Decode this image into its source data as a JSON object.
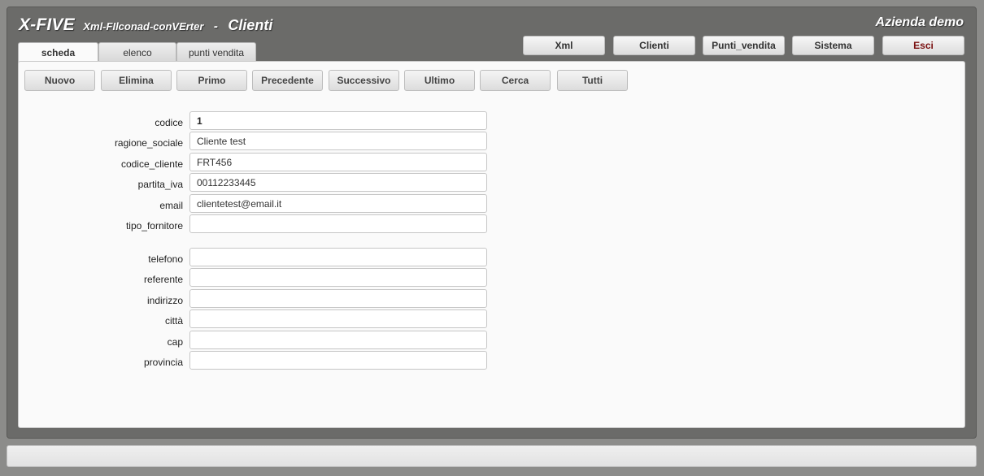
{
  "header": {
    "brand": "X-FIVE",
    "subtitle": "Xml-FIlconad-conVErter",
    "separator": "-",
    "section": "Clienti",
    "company": "Azienda demo"
  },
  "topnav": {
    "items": [
      "Xml",
      "Clienti",
      "Punti_vendita",
      "Sistema",
      "Esci"
    ]
  },
  "tabs": [
    "scheda",
    "elenco",
    "punti vendita"
  ],
  "toolbar": {
    "buttons": [
      "Nuovo",
      "Elimina",
      "Primo",
      "Precedente",
      "Successivo",
      "Ultimo",
      "Cerca",
      "Tutti"
    ]
  },
  "form": {
    "fields": [
      {
        "label": "codice",
        "value": "1"
      },
      {
        "label": "ragione_sociale",
        "value": "Cliente test"
      },
      {
        "label": "codice_cliente",
        "value": "FRT456"
      },
      {
        "label": "partita_iva",
        "value": "00112233445"
      },
      {
        "label": "email",
        "value": "clientetest@email.it"
      },
      {
        "label": "tipo_fornitore",
        "value": ""
      },
      {
        "label": "telefono",
        "value": ""
      },
      {
        "label": "referente",
        "value": ""
      },
      {
        "label": "indirizzo",
        "value": ""
      },
      {
        "label": "città",
        "value": ""
      },
      {
        "label": "cap",
        "value": ""
      },
      {
        "label": "provincia",
        "value": ""
      }
    ]
  }
}
